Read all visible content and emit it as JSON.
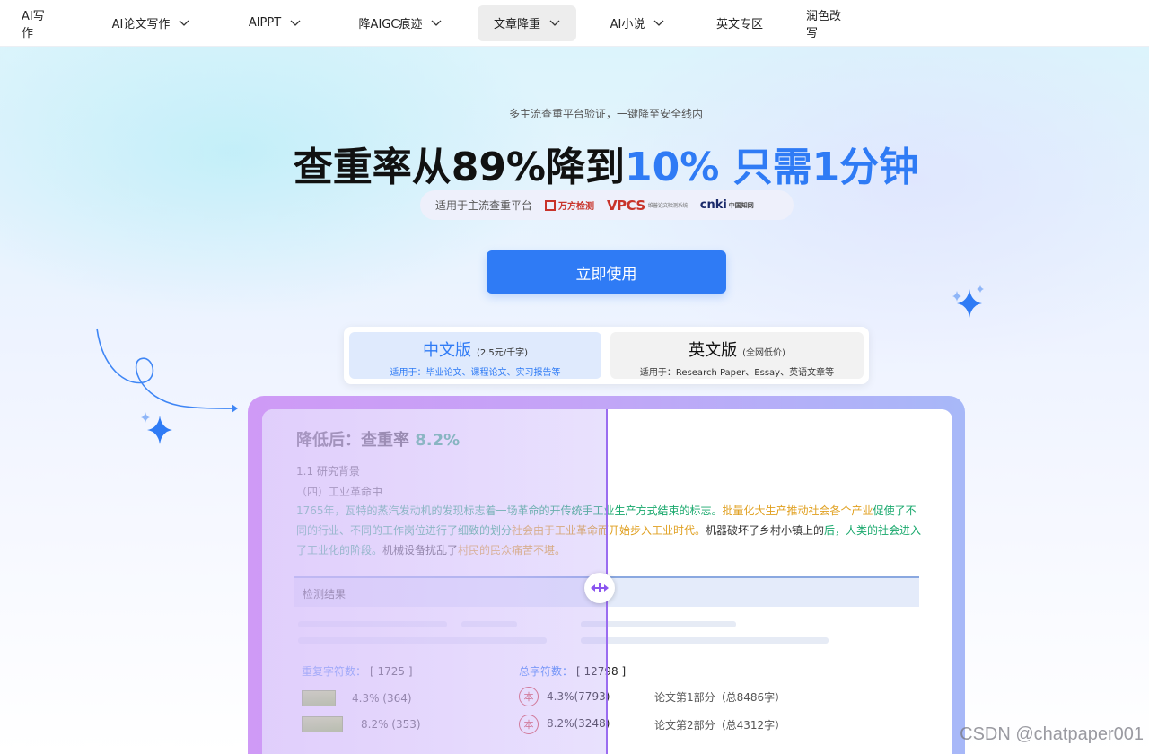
{
  "nav": {
    "items": [
      {
        "label": "AI写作",
        "has_dropdown": false,
        "active": false
      },
      {
        "label": "AI论文写作",
        "has_dropdown": true,
        "active": false
      },
      {
        "label": "AIPPT",
        "has_dropdown": true,
        "active": false
      },
      {
        "label": "降AIGC痕迹",
        "has_dropdown": true,
        "active": false
      },
      {
        "label": "文章降重",
        "has_dropdown": true,
        "active": true
      },
      {
        "label": "AI小说",
        "has_dropdown": true,
        "active": false
      },
      {
        "label": "英文专区",
        "has_dropdown": false,
        "active": false
      },
      {
        "label": "润色改写",
        "has_dropdown": false,
        "active": false
      }
    ]
  },
  "hero": {
    "subtitle": "多主流查重平台验证，一键降至安全线内",
    "headline_dark": "查重率从89%降到",
    "headline_blue": "10% 只需1分钟",
    "platforms_label": "适用于主流查重平台",
    "platform_logos": [
      {
        "icon": "wanfang-logo",
        "text": "万方检测"
      },
      {
        "icon": "vpcs-logo",
        "text": "VPCS",
        "caption": "维普论文检测系统"
      },
      {
        "icon": "cnki-logo",
        "text": "cnki",
        "caption": "中国知网"
      }
    ],
    "cta_label": "立即使用"
  },
  "versions": {
    "zh": {
      "title": "中文版",
      "price": "(2.5元/千字)",
      "sub": "适用于：毕业论文、课程论文、实习报告等"
    },
    "en": {
      "title": "英文版",
      "price": "(全网低价)",
      "sub": "适用于：Research Paper、Essay、英语文章等"
    }
  },
  "compare": {
    "title_label": "降低后：查重率",
    "title_rate": "8.2%",
    "section_heading": "1.1 研究背景",
    "section_sub": "（四）工业革命中",
    "paragraph": [
      {
        "text": "1765年，瓦特的蒸汽发动机的发现标志着一场革命的开传统手工业生产方式结束的标志。",
        "color": "green"
      },
      {
        "text": "批量化大生产推动社会各个产业",
        "color": "orange"
      },
      {
        "text": "促使了不同的行业、不同的工作岗位进行了细致的划分",
        "color": "green"
      },
      {
        "text": "社会由于工业革命而开始步入工业时代。",
        "color": "orange"
      },
      {
        "text": "机器破坏了乡村小镇上的",
        "color": "black"
      },
      {
        "text": "后，人类的社会进入了工业化的阶段。",
        "color": "green"
      },
      {
        "text": "机械设备扰乱了",
        "color": "black"
      },
      {
        "text": "村民的民众痛苦不堪。",
        "color": "orange"
      }
    ],
    "results_heading": "检测结果",
    "dup_label": "重复字符数：",
    "dup_value": "[ 1725 ]",
    "total_label": "总字符数：",
    "total_value": "[ 12798 ]",
    "rows": [
      {
        "left": "4.3% (364)",
        "right": "4.3%(7793)",
        "part": "论文第1部分（总8486字）",
        "seal": "本"
      },
      {
        "left": "8.2% (353)",
        "right": "8.2%(3248)",
        "part": "论文第2部分（总4312字）",
        "seal": "本"
      }
    ]
  },
  "watermark": "CSDN @chatpaper001",
  "colors": {
    "accent": "#2f7bf5",
    "rate_green": "#18a86c",
    "highlight_orange": "#e0a020",
    "slider_purple": "#9a6cf0"
  }
}
